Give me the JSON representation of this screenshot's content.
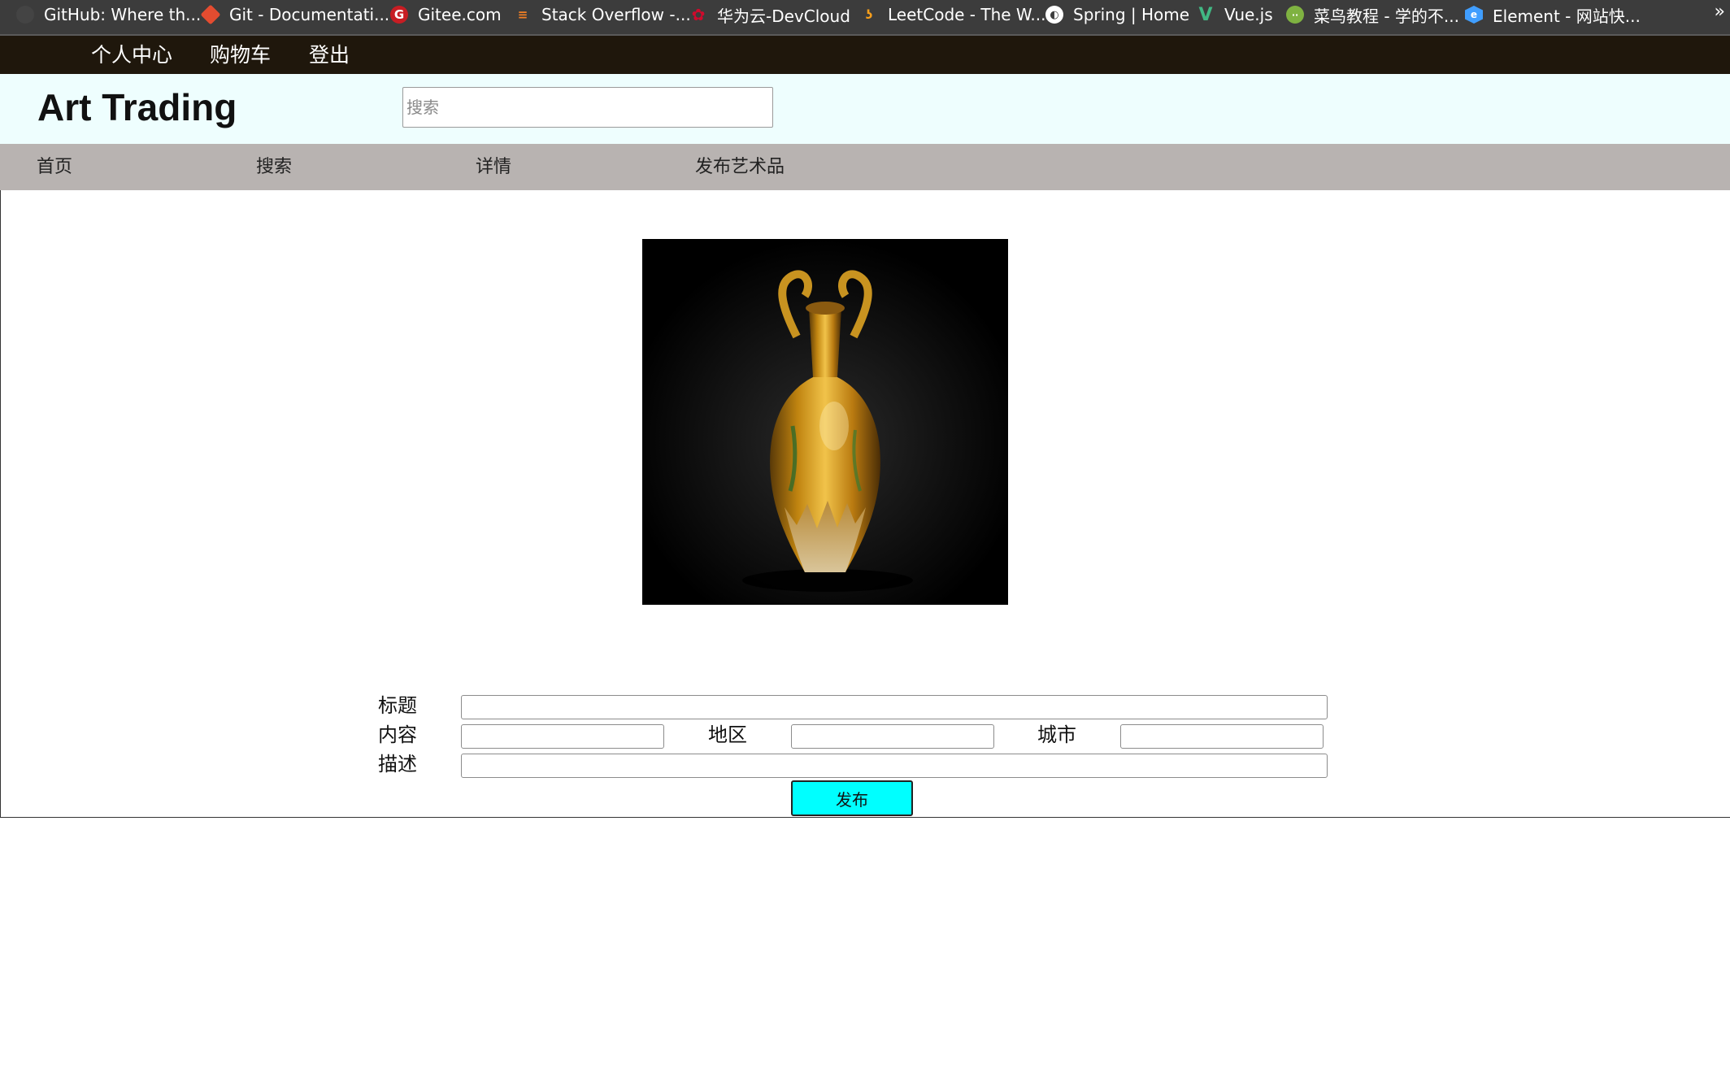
{
  "bookmarks": [
    {
      "label": "GitHub: Where th...",
      "icon": "github-icon",
      "color": "#444444"
    },
    {
      "label": "Git - Documentati...",
      "icon": "git-icon",
      "color": "#e44c30"
    },
    {
      "label": "Gitee.com",
      "icon": "gitee-icon",
      "color": "#c71d23"
    },
    {
      "label": "Stack Overflow -...",
      "icon": "stackoverflow-icon",
      "color": "#f48024"
    },
    {
      "label": "华为云-DevCloud",
      "icon": "huawei-icon",
      "color": "#cf0a2c"
    },
    {
      "label": "LeetCode - The W...",
      "icon": "leetcode-icon",
      "color": "#f89f1b"
    },
    {
      "label": "Spring | Home",
      "icon": "spring-globe-icon",
      "color": "#ffffff"
    },
    {
      "label": "Vue.js",
      "icon": "vue-icon",
      "color": "#41b883"
    },
    {
      "label": "菜鸟教程 - 学的不...",
      "icon": "runoob-icon",
      "color": "#7fb241"
    },
    {
      "label": "Element - 网站快...",
      "icon": "element-icon",
      "color": "#409eff"
    }
  ],
  "bookmarks_more": "»",
  "topnav": {
    "profile": "个人中心",
    "cart": "购物车",
    "logout": "登出"
  },
  "header": {
    "brand": "Art Trading",
    "search_placeholder": "搜索"
  },
  "menu": {
    "home": "首页",
    "search": "搜索",
    "detail": "详情",
    "publish_art": "发布艺术品"
  },
  "form": {
    "title_label": "标题",
    "content_label": "内容",
    "region_label": "地区",
    "city_label": "城市",
    "description_label": "描述",
    "submit_label": "发布"
  },
  "colors": {
    "topnav_bg": "#1f170c",
    "header_bg": "#eefefe",
    "menu_bg": "#b8b3b1",
    "button_bg": "#00ffff"
  }
}
